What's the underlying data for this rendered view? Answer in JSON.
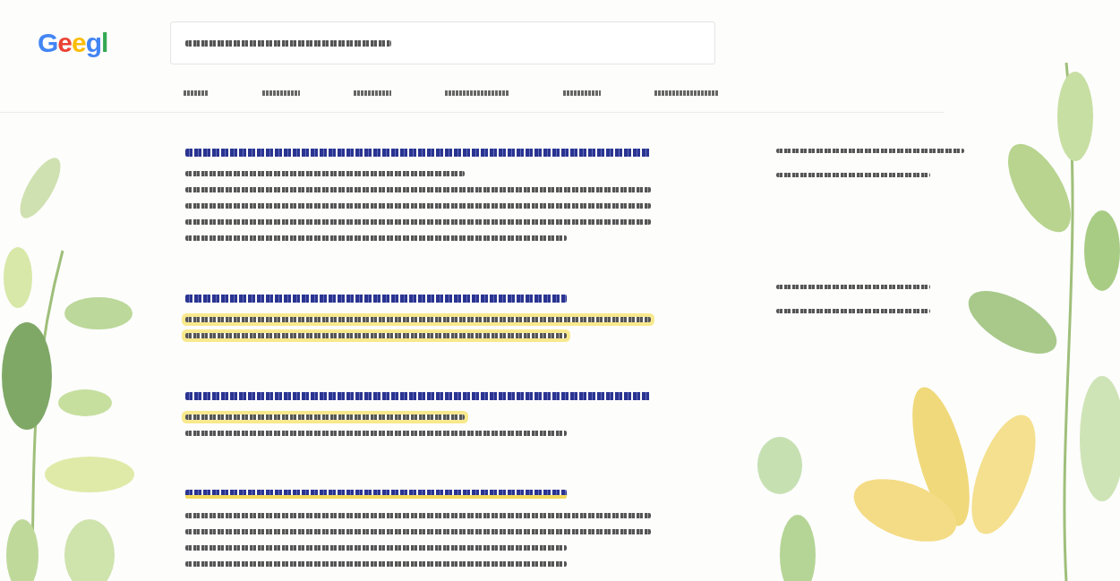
{
  "logo": {
    "text": "Geegl"
  },
  "search": {
    "kind": "medium"
  },
  "tabs": [
    {
      "kind": "xs",
      "selected": false
    },
    {
      "kind": "s",
      "selected": false
    },
    {
      "kind": "s",
      "selected": false
    },
    {
      "kind": "m",
      "selected": false
    },
    {
      "kind": "s",
      "selected": false
    },
    {
      "kind": "m",
      "selected": false
    }
  ],
  "results": [
    {
      "title": {
        "kind": "full",
        "highlight": false
      },
      "lines": [
        {
          "kind": "half",
          "highlight": false
        },
        {
          "kind": "full",
          "highlight": false
        },
        {
          "kind": "full",
          "highlight": false
        },
        {
          "kind": "full",
          "highlight": false
        },
        {
          "kind": "long",
          "highlight": false
        }
      ]
    },
    {
      "title": {
        "kind": "long",
        "highlight": false
      },
      "lines": [
        {
          "kind": "full",
          "highlight": true
        },
        {
          "kind": "long",
          "highlight": true
        }
      ]
    },
    {
      "title": {
        "kind": "full",
        "highlight": false
      },
      "lines": [
        {
          "kind": "half",
          "highlight": true
        },
        {
          "kind": "long",
          "highlight": false
        }
      ]
    },
    {
      "title": {
        "kind": "long",
        "highlight": true
      },
      "lines": [
        {
          "kind": "full",
          "highlight": false
        },
        {
          "kind": "full",
          "highlight": false
        },
        {
          "kind": "long",
          "highlight": false
        },
        {
          "kind": "long",
          "highlight": false
        }
      ]
    }
  ],
  "side_panels": [
    {
      "lines": [
        {
          "kind": "full"
        },
        {
          "kind": "long"
        }
      ]
    },
    {
      "lines": [
        {
          "kind": "long"
        },
        {
          "kind": "long"
        }
      ]
    }
  ]
}
